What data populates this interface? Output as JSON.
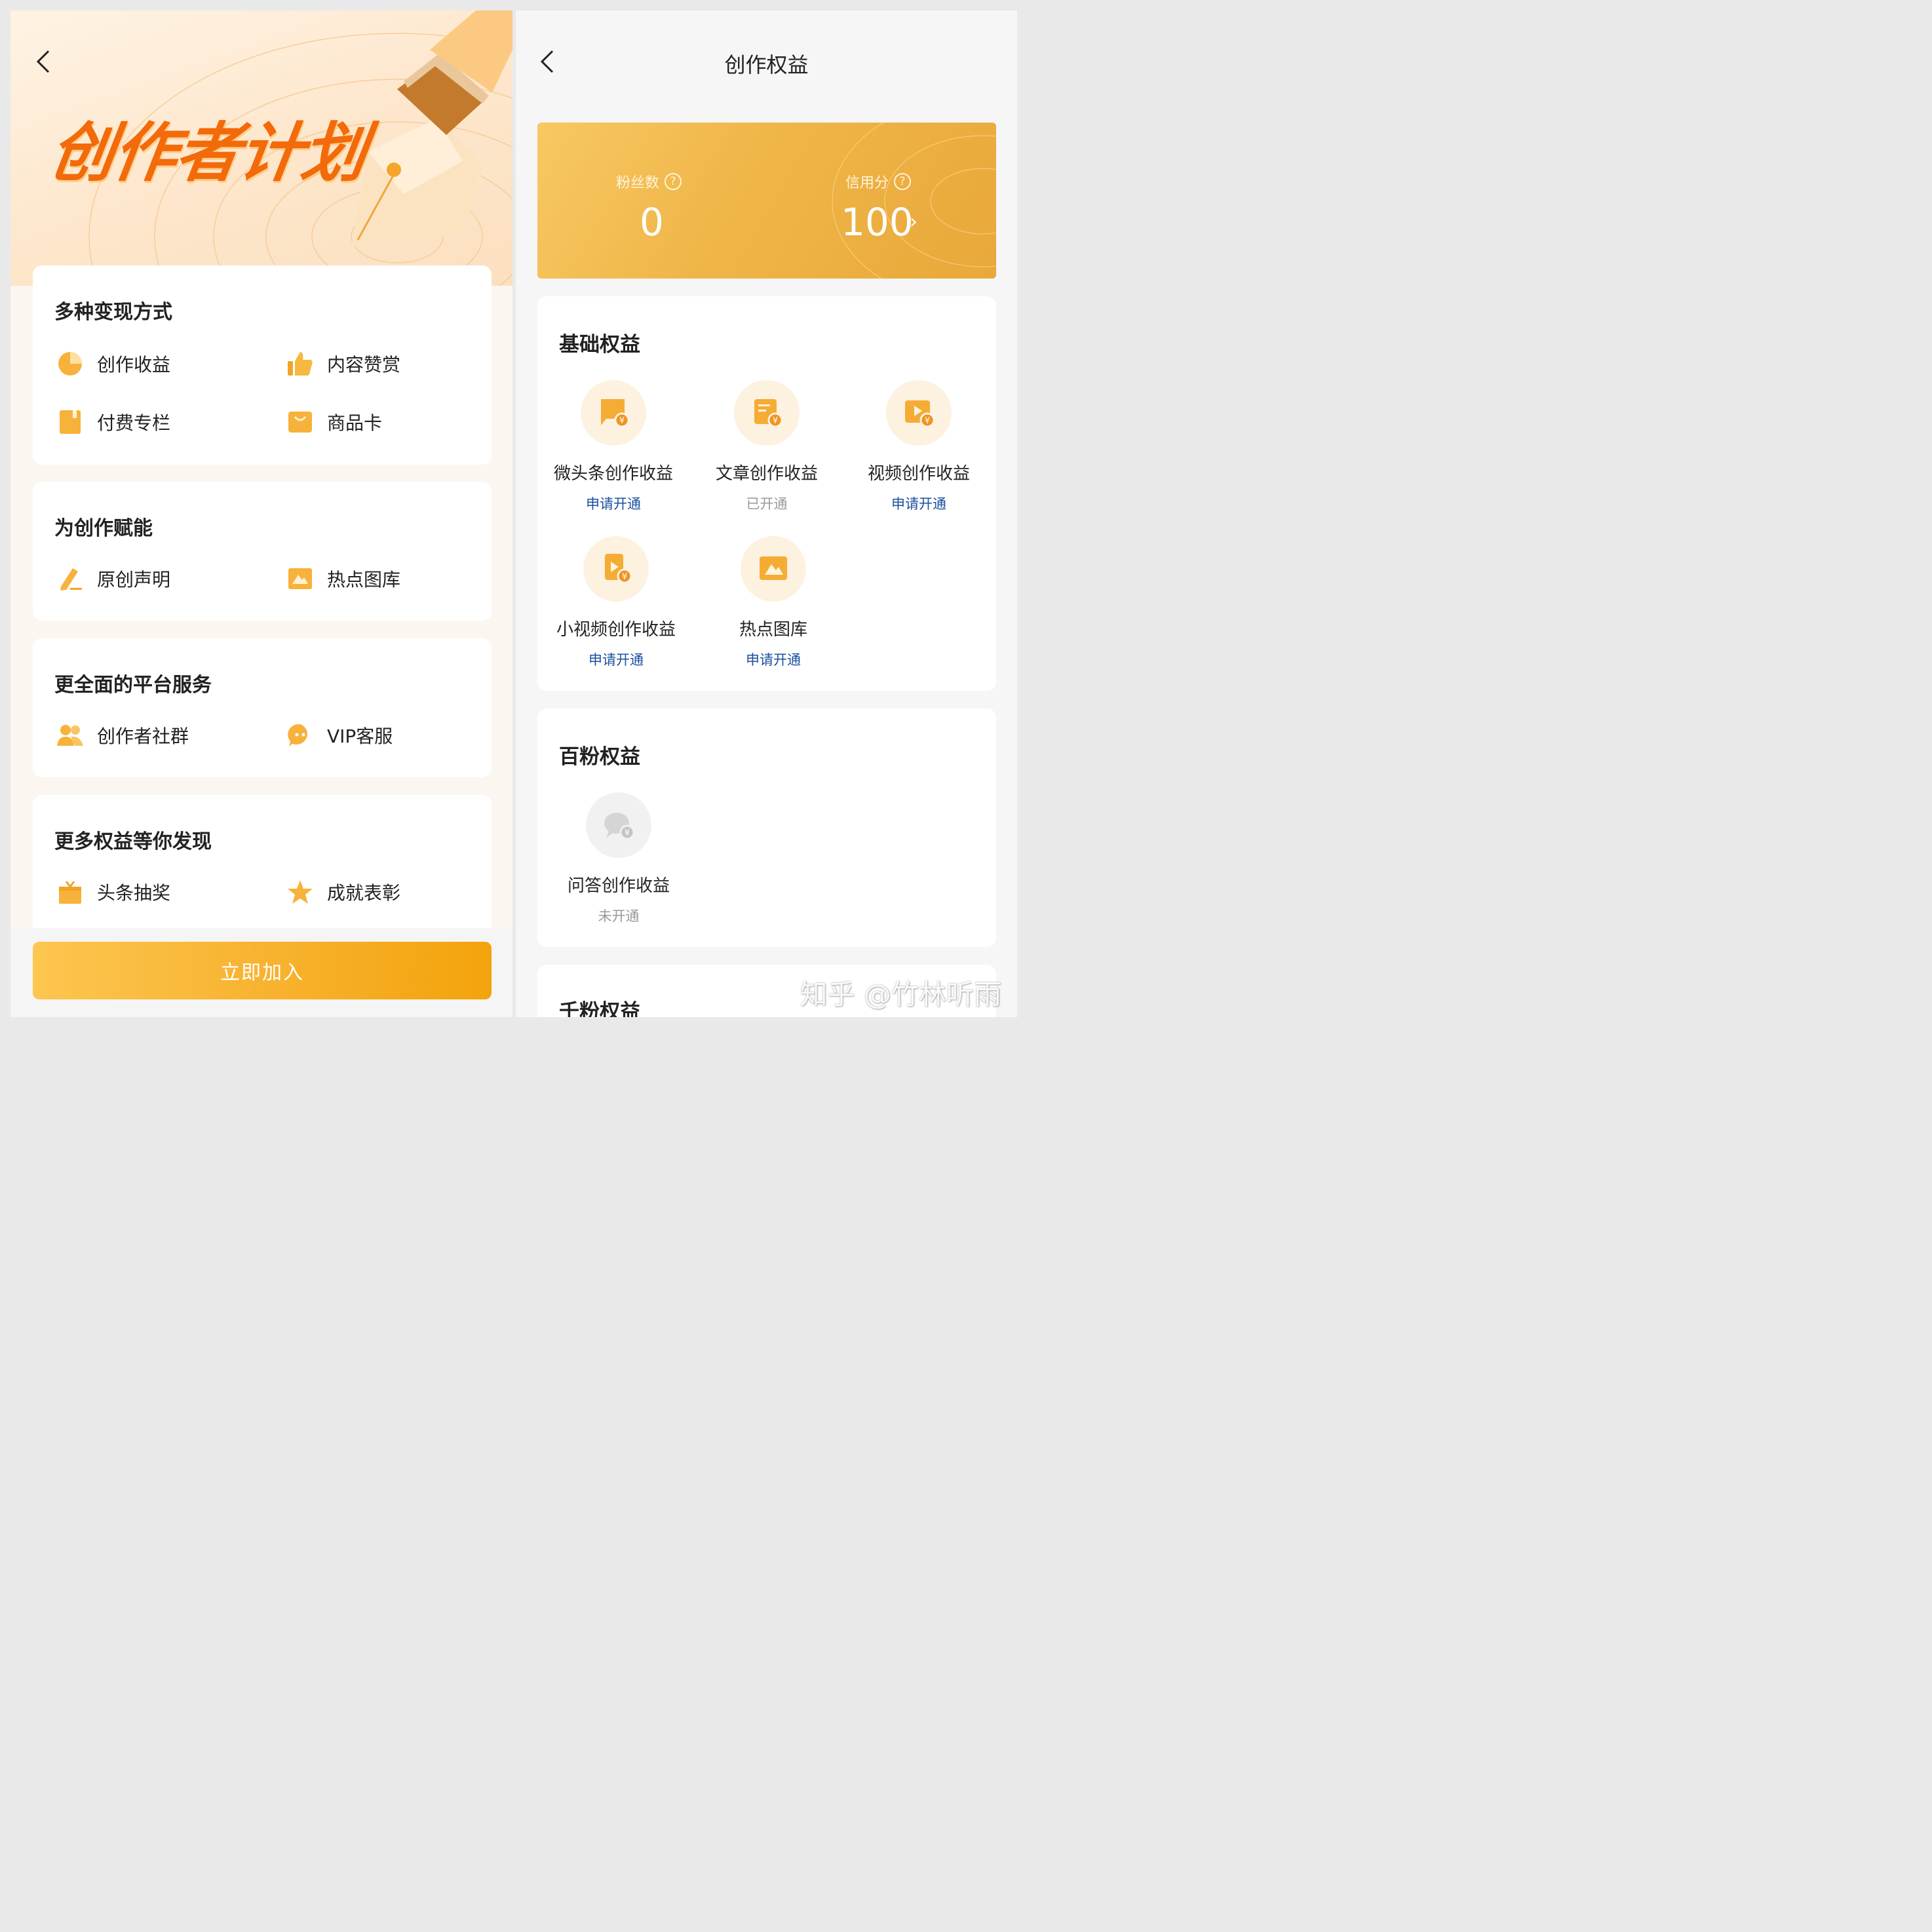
{
  "left": {
    "hero_title": "创作者计划",
    "sections": [
      {
        "title": "多种变现方式",
        "items": [
          {
            "label": "创作收益",
            "icon": "pie-chart-icon"
          },
          {
            "label": "内容赞赏",
            "icon": "thumbs-up-icon"
          },
          {
            "label": "付费专栏",
            "icon": "book-icon"
          },
          {
            "label": "商品卡",
            "icon": "shopping-bag-icon"
          }
        ]
      },
      {
        "title": "为创作赋能",
        "items": [
          {
            "label": "原创声明",
            "icon": "pencil-icon"
          },
          {
            "label": "热点图库",
            "icon": "image-icon"
          }
        ]
      },
      {
        "title": "更全面的平台服务",
        "items": [
          {
            "label": "创作者社群",
            "icon": "people-icon"
          },
          {
            "label": "VIP客服",
            "icon": "chat-icon"
          }
        ]
      },
      {
        "title": "更多权益等你发现",
        "items": [
          {
            "label": "头条抽奖",
            "icon": "gift-icon"
          },
          {
            "label": "成就表彰",
            "icon": "star-icon"
          }
        ]
      }
    ],
    "join_button": "立即加入"
  },
  "right": {
    "title": "创作权益",
    "stats": {
      "fans_label": "粉丝数",
      "fans_value": "0",
      "credit_label": "信用分",
      "credit_value": "100",
      "help_icon": "?"
    },
    "basic": {
      "title": "基础权益",
      "items": [
        {
          "name": "微头条创作收益",
          "status": "申请开通",
          "icon": "chat-coin-icon"
        },
        {
          "name": "文章创作收益",
          "status": "已开通",
          "icon": "document-coin-icon"
        },
        {
          "name": "视频创作收益",
          "status": "申请开通",
          "icon": "video-coin-icon"
        },
        {
          "name": "小视频创作收益",
          "status": "申请开通",
          "icon": "short-video-coin-icon"
        },
        {
          "name": "热点图库",
          "status": "申请开通",
          "icon": "image-icon"
        }
      ]
    },
    "hundred": {
      "title": "百粉权益",
      "items": [
        {
          "name": "问答创作收益",
          "status": "未开通",
          "icon": "qa-coin-icon"
        }
      ]
    },
    "thousand": {
      "title": "千粉权益"
    },
    "watermark": "知乎 @竹林听雨"
  },
  "colors": {
    "accent": "#f5a623",
    "orange_title": "#f26a0a",
    "link": "#1a4fa0"
  }
}
